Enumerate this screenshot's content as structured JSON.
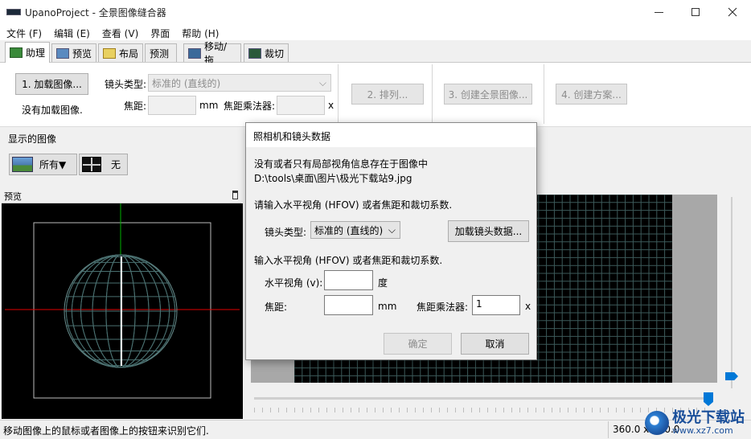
{
  "window": {
    "title": "UpanoProject - 全景图像缝合器",
    "app_icon_label": "Upano"
  },
  "menu": [
    "文件 (F)",
    "编辑 (E)",
    "查看 (V)",
    "界面",
    "帮助 (H)"
  ],
  "tabs": [
    {
      "label": "助理",
      "active": true
    },
    {
      "label": "预览",
      "active": false
    },
    {
      "label": "布局",
      "active": false
    },
    {
      "label": "预测",
      "active": false
    },
    {
      "label": "移动/拖",
      "active": false
    },
    {
      "label": "裁切",
      "active": false
    }
  ],
  "assistant": {
    "load_images_button": "1. 加载图像...",
    "no_images_text": "没有加载图像.",
    "lens_type_label": "镜头类型:",
    "lens_type_value": "标准的 (直线的)",
    "focal_label": "焦距:",
    "focal_unit": "mm",
    "multiplier_label": "焦距乘法器:",
    "multiplier_unit": "x",
    "align_button": "2. 排列...",
    "create_panorama_button": "3. 创建全景图像...",
    "create_project_button": "4. 创建方案..."
  },
  "images_group": {
    "label": "显示的图像",
    "all_button": "所有▼",
    "none_button": "无"
  },
  "preview": {
    "title": "预览",
    "pin_icon": "pin-icon"
  },
  "dialog": {
    "title": "照相机和镜头数据",
    "info_line1": "没有或者只有局部视角信息存在于图像中",
    "info_line2": "D:\\tools\\桌面\\图片\\极光下载站9.jpg",
    "prompt1": "请输入水平视角 (HFOV) 或者焦距和裁切系数.",
    "lens_type_label": "镜头类型:",
    "lens_type_value": "标准的 (直线的)",
    "load_lens_button": "加载镜头数据...",
    "prompt2": "输入水平视角 (HFOV) 或者焦距和裁切系数.",
    "hfov_label": "水平视角 (v):",
    "hfov_value": "",
    "hfov_unit": "度",
    "focal_label": "焦距:",
    "focal_value": "",
    "focal_unit": "mm",
    "multiplier_label": "焦距乘法器:",
    "multiplier_value": "1",
    "multiplier_unit": "x",
    "ok_button": "确定",
    "cancel_button": "取消"
  },
  "status": {
    "message": "移动图像上的鼠标或者图像上的按钮来识别它们.",
    "fov": "360.0 x 180.0"
  },
  "watermark": {
    "text": "极光下载站",
    "url": "www.xz7.com"
  },
  "colors": {
    "accent": "#0078d7",
    "grid_line": "#3c5a5a",
    "axis_red": "#e00000",
    "axis_green": "#00b000"
  }
}
